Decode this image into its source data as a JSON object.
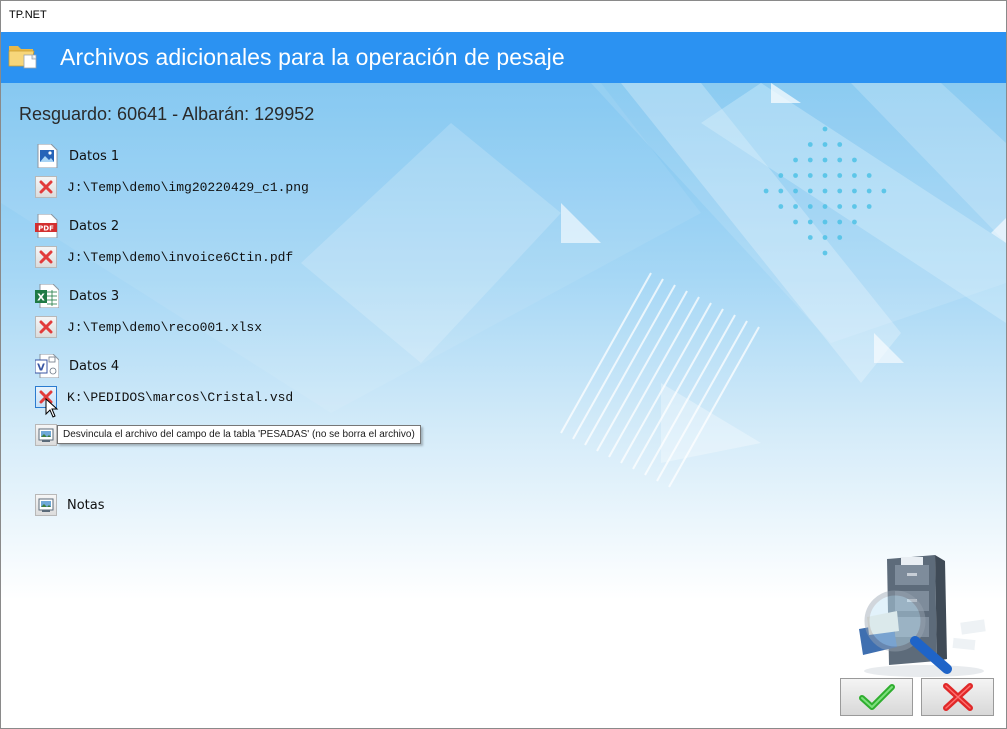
{
  "window": {
    "title": "TP.NET"
  },
  "header": {
    "title": "Archivos adicionales para la operación de pesaje",
    "icon": "folder-icon"
  },
  "subheader": "Resguardo: 60641 - Albarán: 129952",
  "entries": [
    {
      "name": "Datos 1",
      "icon": "image-file-icon",
      "path": "J:\\Temp\\demo\\img20220429_c1.png"
    },
    {
      "name": "Datos 2",
      "icon": "pdf-file-icon",
      "path": "J:\\Temp\\demo\\invoice6Ctin.pdf"
    },
    {
      "name": "Datos 3",
      "icon": "excel-file-icon",
      "path": "J:\\Temp\\demo\\reco001.xlsx"
    },
    {
      "name": "Datos 4",
      "icon": "visio-file-icon",
      "path": "K:\\PEDIDOS\\marcos\\Cristal.vsd"
    }
  ],
  "tooltip": "Desvincula el archivo del campo de la tabla 'PESADAS' (no se borra el archivo)",
  "notes": {
    "label": "Notas"
  },
  "buttons": {
    "ok": "check-icon",
    "cancel": "x-icon"
  },
  "colors": {
    "header": "#2b92f2",
    "remove": "#e23b3b",
    "ok": "#2fae2f"
  }
}
